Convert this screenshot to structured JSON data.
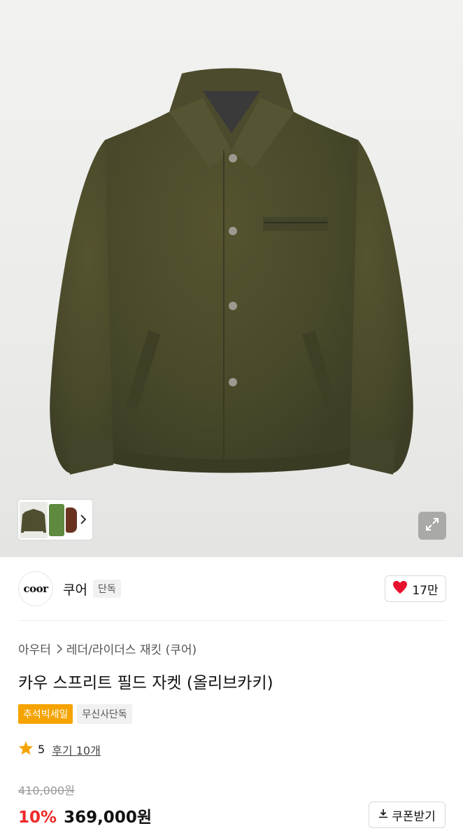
{
  "gallery": {
    "thumbnails": [
      "olive-jacket",
      "green-jacket",
      "brown-jacket"
    ],
    "expand_icon": "expand-icon",
    "next_icon": "chevron-right-icon"
  },
  "brand": {
    "logo_text": "coor",
    "name": "쿠어",
    "badge": "단독"
  },
  "like": {
    "icon": "heart-icon",
    "count": "17만",
    "color": "#e8112d"
  },
  "breadcrumb": {
    "category": "아우터",
    "subcategory": "레더/라이더스 재킷 (쿠어)"
  },
  "product": {
    "title": "카우 스프리트 필드 자켓 (올리브카키)",
    "tags": [
      "추석빅세일",
      "무신사단독"
    ]
  },
  "rating": {
    "icon": "star-icon",
    "score": "5",
    "reviews": "후기 10개"
  },
  "price": {
    "original": "410,000원",
    "discount": "10%",
    "final": "369,000원"
  },
  "coupon": {
    "icon": "download-icon",
    "label": "쿠폰받기"
  },
  "colors": {
    "accent_orange": "#f5a300",
    "discount_red": "#ee2a2a",
    "jacket_olive": "#4f4e2f"
  }
}
